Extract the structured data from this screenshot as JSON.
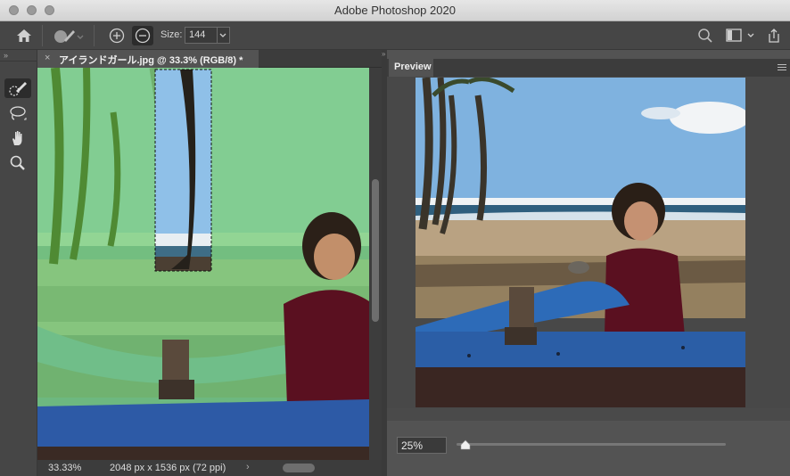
{
  "window": {
    "title": "Adobe Photoshop 2020"
  },
  "options_bar": {
    "icons": [
      "home-icon",
      "brush-preset-icon",
      "add-mode-icon",
      "subtract-mode-icon",
      "search-icon",
      "workspace-icon",
      "share-icon"
    ],
    "size_label": "Size:",
    "size_value": "144"
  },
  "toolbar": {
    "tools": [
      "quick-selection-icon",
      "lasso-icon",
      "hand-icon",
      "zoom-icon"
    ],
    "active_tool": "quick-selection-icon"
  },
  "document": {
    "tab_title": "アイランドガール.jpg @ 33.3% (RGB/8) *",
    "close_glyph": "×",
    "mask_overlay_color": "#7fd07f"
  },
  "status_bar": {
    "zoom": "33.33%",
    "doc_info": "2048 px x 1536 px (72 ppi)",
    "arrow": "›"
  },
  "preview": {
    "tab_label": "Preview",
    "zoom_value": "25%",
    "zoom_slider_fraction": 0.03
  }
}
